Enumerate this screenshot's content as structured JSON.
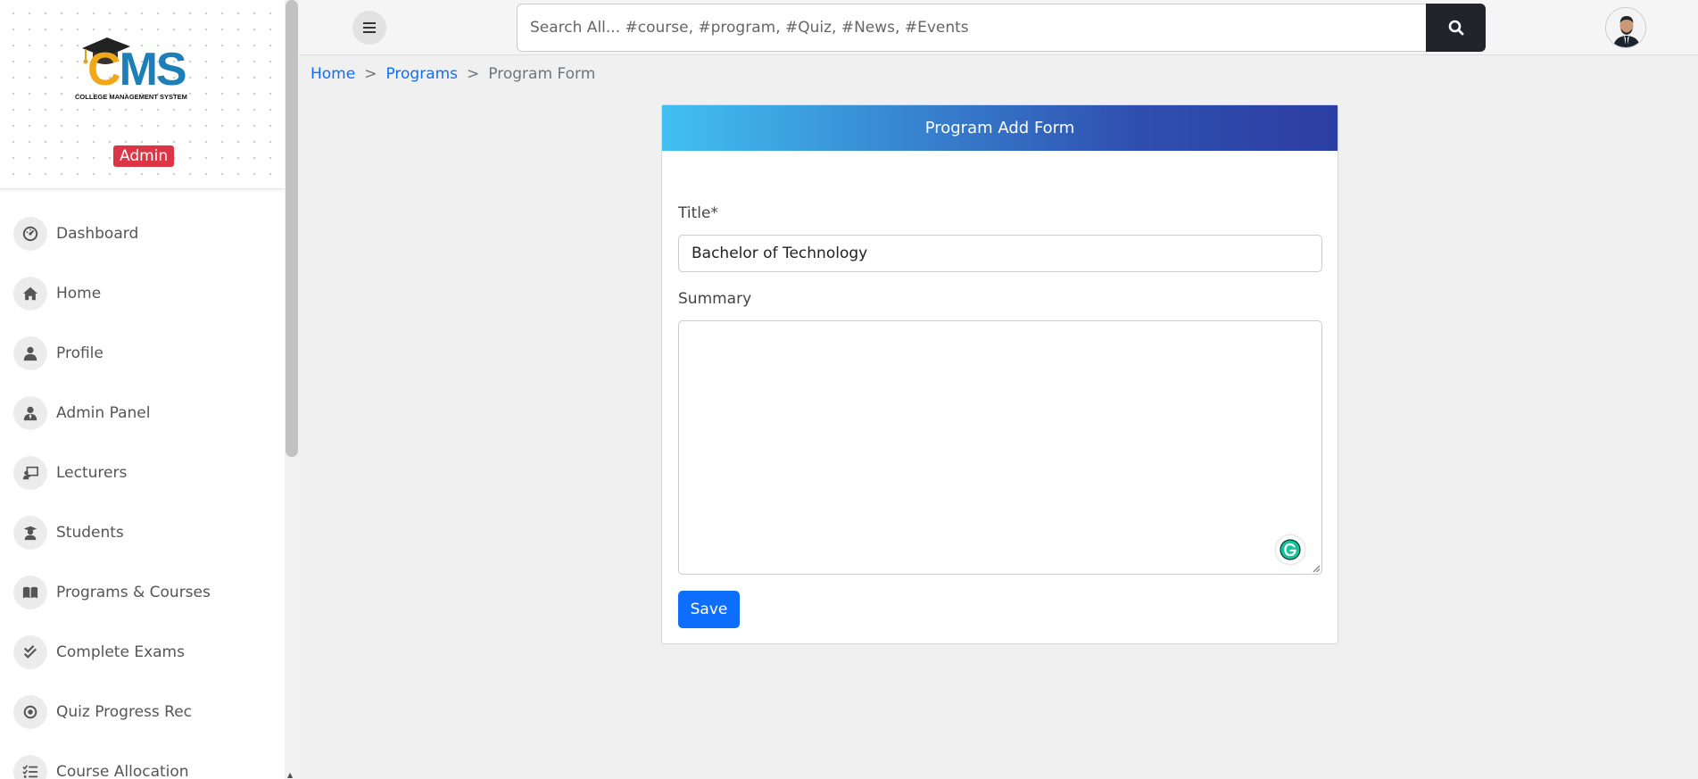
{
  "brand": {
    "logo_text_c": "C",
    "logo_text_ms": "MS",
    "logo_subtitle": "COLLEGE MANAGEMENT SYSTEM",
    "role": "Admin"
  },
  "sidebar": {
    "items": [
      {
        "label": "Dashboard",
        "icon": "dashboard-icon"
      },
      {
        "label": "Home",
        "icon": "home-icon"
      },
      {
        "label": "Profile",
        "icon": "user-icon"
      },
      {
        "label": "Admin Panel",
        "icon": "user-tie-icon"
      },
      {
        "label": "Lecturers",
        "icon": "chalkboard-teacher-icon"
      },
      {
        "label": "Students",
        "icon": "graduate-icon"
      },
      {
        "label": "Programs & Courses",
        "icon": "book-open-icon"
      },
      {
        "label": "Complete Exams",
        "icon": "check-double-icon"
      },
      {
        "label": "Quiz Progress Rec",
        "icon": "record-icon"
      },
      {
        "label": "Course Allocation",
        "icon": "tasks-icon"
      }
    ]
  },
  "topbar": {
    "search_placeholder": "Search All... #course, #program, #Quiz, #News, #Events"
  },
  "breadcrumb": {
    "home": "Home",
    "programs": "Programs",
    "current": "Program Form",
    "separator": ">"
  },
  "form": {
    "header": "Program Add Form",
    "title_label": "Title*",
    "title_value": "Bachelor of Technology",
    "summary_label": "Summary",
    "summary_value": "",
    "save_label": "Save"
  },
  "colors": {
    "accent": "#0d6efd",
    "role_badge": "#dc3545",
    "header_gradient_start": "#41c0f2",
    "header_gradient_end": "#2d3ea3"
  }
}
